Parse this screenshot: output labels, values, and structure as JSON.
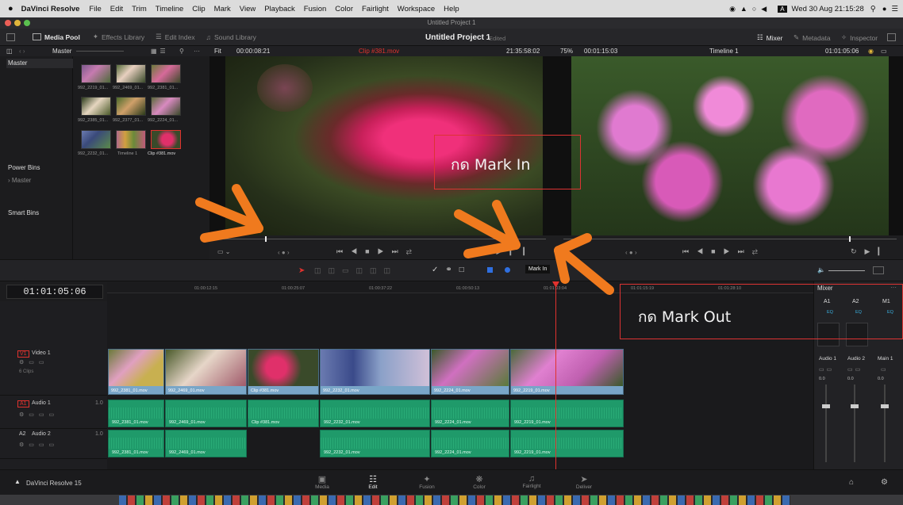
{
  "menubar": {
    "apple": "",
    "app_name": "DaVinci Resolve",
    "items": [
      "File",
      "Edit",
      "Trim",
      "Timeline",
      "Clip",
      "Mark",
      "View",
      "Playback",
      "Fusion",
      "Color",
      "Fairlight",
      "Workspace",
      "Help"
    ],
    "clock": "Wed 30 Aug  21:15:28"
  },
  "window": {
    "title": "Untitled Project 1"
  },
  "toolbar": {
    "media_pool": "Media Pool",
    "effects_library": "Effects Library",
    "edit_index": "Edit Index",
    "sound_library": "Sound Library",
    "project_title": "Untitled Project 1",
    "project_status": "Edited",
    "mixer": "Mixer",
    "metadata": "Metadata",
    "inspector": "Inspector"
  },
  "subbar": {
    "bin": "Master",
    "fit": "Fit",
    "source_duration": "00:00:08:21",
    "source_clip": "Clip #381.mov",
    "source_tc": "21:35:58:02",
    "zoom": "75%",
    "timeline_duration": "00:01:15:03",
    "timeline_name": "Timeline 1",
    "timeline_tc": "01:01:05:06"
  },
  "bins": {
    "master": "Master",
    "power_bins": "Power Bins",
    "power_master": "Master",
    "smart_bins": "Smart Bins"
  },
  "clips": [
    {
      "name": "992_2219_01..."
    },
    {
      "name": "992_2469_01..."
    },
    {
      "name": "992_2381_01..."
    },
    {
      "name": "992_2385_01..."
    },
    {
      "name": "992_2377_01..."
    },
    {
      "name": "992_2224_01..."
    },
    {
      "name": "992_2232_01..."
    },
    {
      "name": "Timeline 1"
    },
    {
      "name": "Clip #381.mov"
    }
  ],
  "annotations": {
    "mark_in": "กด Mark In",
    "mark_out": "กด Mark Out"
  },
  "edit_toolbar": {
    "tooltip": "Mark In"
  },
  "timeline": {
    "timecode": "01:01:05:06",
    "ruler": [
      "01:00:12:15",
      "01:00:25:07",
      "01:00:37:22",
      "01:00:50:13",
      "01:01:03:04",
      "01:01:15:19",
      "01:01:28:10"
    ],
    "tracks": {
      "v1_id": "V1",
      "v1_name": "Video 1",
      "v1_count": "6 Clips",
      "a1_id": "A1",
      "a1_name": "Audio 1",
      "a1_level": "1.0",
      "a2_id": "A2",
      "a2_name": "Audio 2",
      "a2_level": "1.0"
    },
    "video_clips": [
      "992_2381_01.mov",
      "992_2469_01.mov",
      "Clip #381.mov",
      "992_2232_01.mov",
      "992_2224_01.mov",
      "992_2219_01.mov"
    ],
    "audio1_clips": [
      "992_2381_01.mov",
      "992_2469_01.mov",
      "Clip #381.mov",
      "992_2232_01.mov",
      "992_2224_01.mov",
      "992_2219_01.mov"
    ],
    "audio2_clips": [
      "992_2381_01.mov",
      "992_2469_01.mov",
      "992_2232_01.mov",
      "992_2224_01.mov",
      "992_2219_01.mov"
    ]
  },
  "mixer": {
    "title": "Mixer",
    "channels": [
      "A1",
      "A2",
      "M1"
    ],
    "eq": [
      "EQ",
      "EQ",
      "EQ"
    ],
    "strips": [
      "Audio 1",
      "Audio 2",
      "Main 1"
    ],
    "levels": [
      "0.0",
      "0.0",
      "0.0"
    ]
  },
  "pages": {
    "brand": "DaVinci Resolve 15",
    "items": [
      "Media",
      "Edit",
      "Fusion",
      "Color",
      "Fairlight",
      "Deliver"
    ],
    "active": "Edit"
  },
  "colors": {
    "annotation_red": "#d33333",
    "arrow_orange": "#f07a1e",
    "video_clip": "#79a6c8",
    "audio_clip": "#1f9a6a",
    "playhead": "#e0322e"
  }
}
